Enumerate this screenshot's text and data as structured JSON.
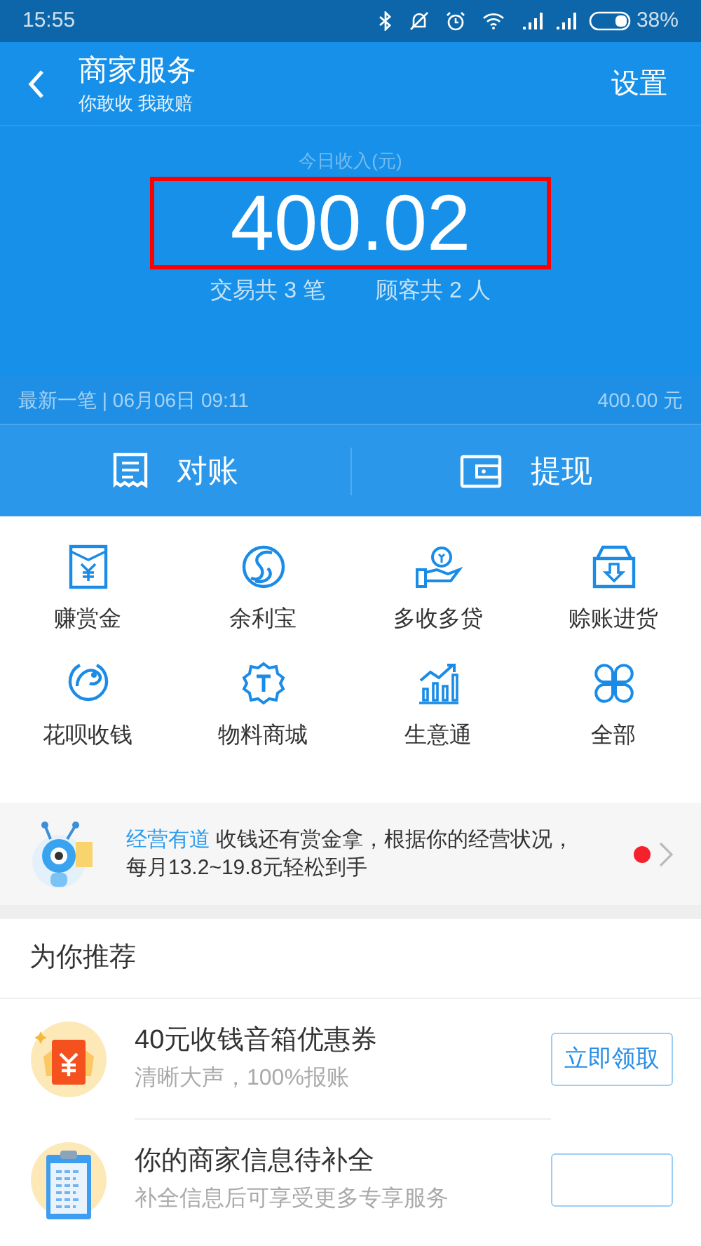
{
  "status_bar": {
    "time": "15:55",
    "battery": "38%"
  },
  "header": {
    "title": "商家服务",
    "subtitle": "你敢收 我敢赔",
    "action": "设置"
  },
  "summary": {
    "label": "今日收入(元)",
    "amount": "400.02",
    "highlighted": true,
    "transactions": "交易共 3 笔",
    "customers": "顾客共 2 人"
  },
  "latest": {
    "label": "最新一笔 | 06月06日 09:11",
    "amount": "400.00 元"
  },
  "actions": [
    {
      "label": "对账"
    },
    {
      "label": "提现"
    }
  ],
  "services": [
    {
      "label": "赚赏金"
    },
    {
      "label": "余利宝"
    },
    {
      "label": "多收多贷"
    },
    {
      "label": "赊账进货"
    },
    {
      "label": "花呗收钱"
    },
    {
      "label": "物料商城"
    },
    {
      "label": "生意通"
    },
    {
      "label": "全部"
    }
  ],
  "banner": {
    "tag": "经营有道",
    "text": "收钱还有赏金拿，根据你的经营状况，每月13.2~19.8元轻松到手",
    "unread": true
  },
  "recommend": {
    "title": "为你推荐",
    "items": [
      {
        "title": "40元收钱音箱优惠券",
        "subtitle": "清晰大声，100%报账",
        "button": "立即领取"
      },
      {
        "title": "你的商家信息待补全",
        "subtitle": "补全信息后可享受更多专享服务"
      }
    ]
  }
}
